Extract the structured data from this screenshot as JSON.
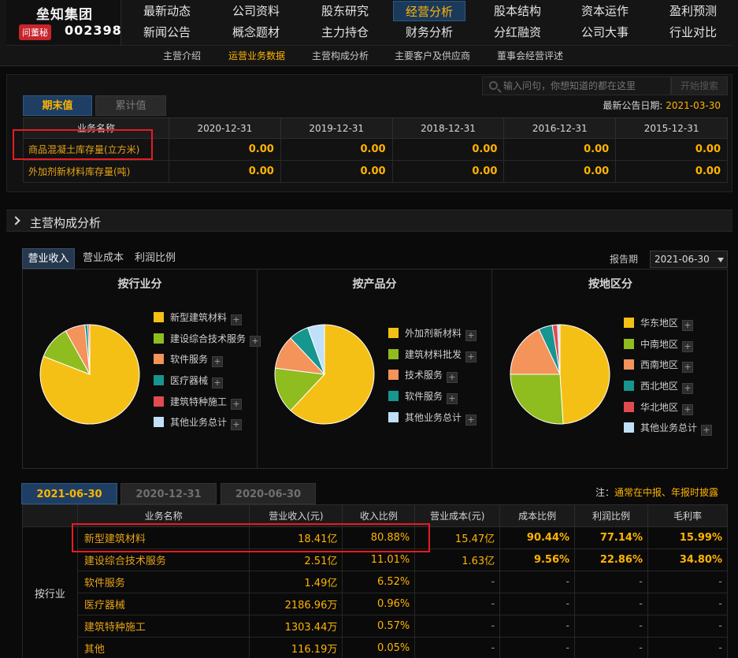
{
  "brand": {
    "name": "垒知集团",
    "badge": "问董秘",
    "code": "002398"
  },
  "nav": {
    "row1": [
      "最新动态",
      "公司资料",
      "股东研究",
      "经营分析",
      "股本结构",
      "资本运作",
      "盈利预测"
    ],
    "row2": [
      "新闻公告",
      "概念题材",
      "主力持仓",
      "财务分析",
      "分红融资",
      "公司大事",
      "行业对比"
    ],
    "active": "经营分析"
  },
  "subnav": {
    "items": [
      "主营介绍",
      "运营业务数据",
      "主营构成分析",
      "主要客户及供应商",
      "董事会经营评述"
    ],
    "active": "运营业务数据"
  },
  "search": {
    "placeholder": "输入问句，你想知道的都在这里",
    "button": "开始搜索"
  },
  "operations": {
    "tabs": [
      "期末值",
      "累计值"
    ],
    "announce_label": "最新公告日期:",
    "announce_date": "2021-03-30",
    "header_name": "业务名称",
    "dates": [
      "2020-12-31",
      "2019-12-31",
      "2018-12-31",
      "2016-12-31",
      "2015-12-31"
    ],
    "rows": [
      {
        "name": "商品混凝土库存量(立方米)",
        "values": [
          "0.00",
          "0.00",
          "0.00",
          "0.00",
          "0.00"
        ]
      },
      {
        "name": "外加剂新材料库存量(吨)",
        "values": [
          "0.00",
          "0.00",
          "0.00",
          "0.00",
          "0.00"
        ]
      }
    ]
  },
  "composition": {
    "title": "主营构成分析",
    "tabs": [
      "营业收入",
      "营业成本",
      "利润比例"
    ],
    "report_label": "报告期",
    "report_value": "2021-06-30"
  },
  "colors": {
    "yellow": "#f5c016",
    "green": "#8fbc1e",
    "orange": "#f4935a",
    "teal": "#17958f",
    "red": "#e14b50",
    "lightblue": "#bfe0f8",
    "accent": "#ffb400"
  },
  "chart_data": [
    {
      "type": "pie",
      "title": "按行业分",
      "labels": [
        "新型建筑材料",
        "建设综合技术服务",
        "软件服务",
        "医疗器械",
        "建筑特种施工",
        "其他业务总计"
      ],
      "values": [
        80.88,
        11.01,
        6.52,
        0.96,
        0.57,
        0.05
      ],
      "colors": [
        "#f5c016",
        "#8fbc1e",
        "#f4935a",
        "#17958f",
        "#e14b50",
        "#bfe0f8"
      ]
    },
    {
      "type": "pie",
      "title": "按产品分",
      "labels": [
        "外加剂新材料",
        "建筑材料批发",
        "技术服务",
        "软件服务",
        "其他业务总计"
      ],
      "values": [
        62,
        15,
        11,
        6.5,
        5.5
      ],
      "colors": [
        "#f5c016",
        "#8fbc1e",
        "#f4935a",
        "#17958f",
        "#bfe0f8"
      ]
    },
    {
      "type": "pie",
      "title": "按地区分",
      "labels": [
        "华东地区",
        "中南地区",
        "西南地区",
        "西北地区",
        "华北地区",
        "其他业务总计"
      ],
      "values": [
        49,
        26,
        18,
        4.5,
        1.7,
        0.8
      ],
      "colors": [
        "#f5c016",
        "#8fbc1e",
        "#f4935a",
        "#17958f",
        "#e14b50",
        "#bfe0f8"
      ]
    }
  ],
  "detail": {
    "periods": [
      "2021-06-30",
      "2020-12-31",
      "2020-06-30"
    ],
    "note_prefix": "注：",
    "note_text": "通常在中报、年报时披露",
    "headers": [
      "业务名称",
      "营业收入(元)",
      "收入比例",
      "营业成本(元)",
      "成本比例",
      "利润比例",
      "毛利率"
    ],
    "group": "按行业",
    "rows": [
      [
        "新型建筑材料",
        "18.41亿",
        "80.88%",
        "15.47亿",
        "90.44%",
        "77.14%",
        "15.99%"
      ],
      [
        "建设综合技术服务",
        "2.51亿",
        "11.01%",
        "1.63亿",
        "9.56%",
        "22.86%",
        "34.80%"
      ],
      [
        "软件服务",
        "1.49亿",
        "6.52%",
        "-",
        "-",
        "-",
        "-"
      ],
      [
        "医疗器械",
        "2186.96万",
        "0.96%",
        "-",
        "-",
        "-",
        "-"
      ],
      [
        "建筑特种施工",
        "1303.44万",
        "0.57%",
        "-",
        "-",
        "-",
        "-"
      ],
      [
        "其他",
        "116.19万",
        "0.05%",
        "-",
        "-",
        "-",
        "-"
      ]
    ]
  }
}
